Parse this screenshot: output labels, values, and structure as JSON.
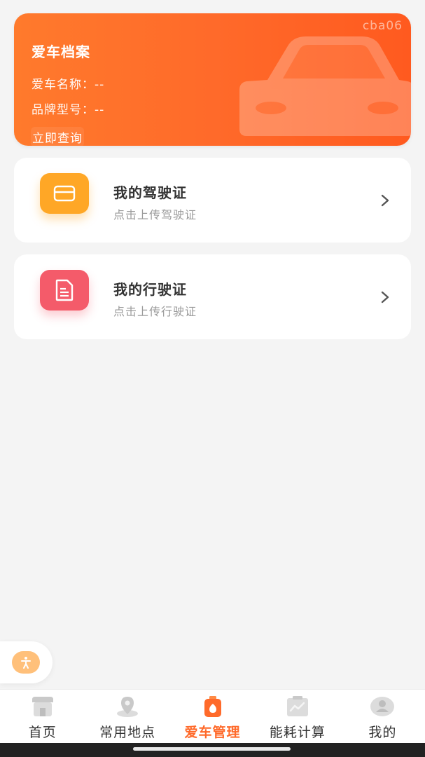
{
  "car_profile": {
    "title": "爱车档案",
    "name_label": "爱车名称：",
    "name_value": "--",
    "model_label": "品牌型号：",
    "model_value": "--",
    "query_label": "立即查询",
    "watermark": "cba06",
    "gradient_start": "#ff7a2c",
    "gradient_end": "#ff5a1f"
  },
  "documents": [
    {
      "title": "我的驾驶证",
      "subtitle": "点击上传驾驶证",
      "icon": "card-icon",
      "color": "#ffa726"
    },
    {
      "title": "我的行驶证",
      "subtitle": "点击上传行驶证",
      "icon": "document-icon",
      "color": "#f45b6a"
    }
  ],
  "floating_button": {
    "icon": "accessibility-icon",
    "color": "#ffc07a"
  },
  "tabbar": {
    "active_color": "#ff6a2a",
    "tabs": [
      {
        "label": "首页",
        "icon": "store-icon",
        "active": false
      },
      {
        "label": "常用地点",
        "icon": "map-pin-icon",
        "active": false
      },
      {
        "label": "爱车管理",
        "icon": "car-manage-icon",
        "active": true
      },
      {
        "label": "能耗计算",
        "icon": "chart-icon",
        "active": false
      },
      {
        "label": "我的",
        "icon": "profile-icon",
        "active": false
      }
    ]
  }
}
